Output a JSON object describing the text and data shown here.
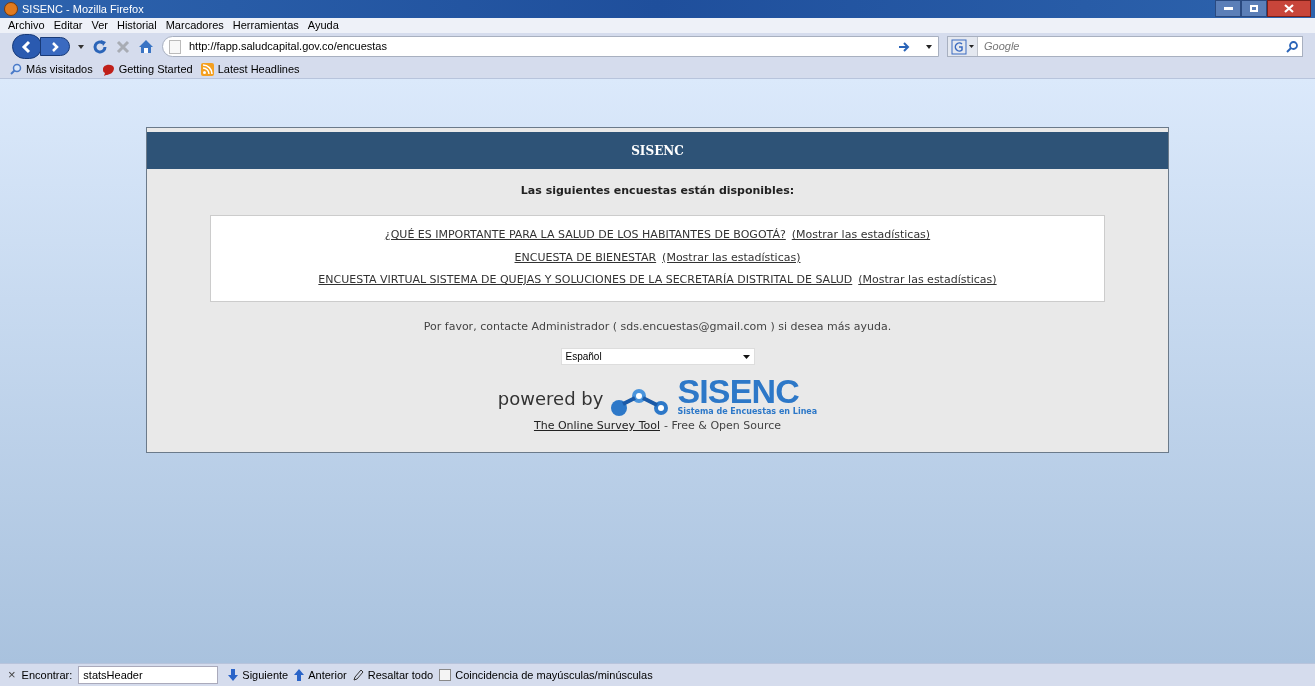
{
  "window": {
    "title": "SISENC - Mozilla Firefox"
  },
  "menu": [
    "Archivo",
    "Editar",
    "Ver",
    "Historial",
    "Marcadores",
    "Herramientas",
    "Ayuda"
  ],
  "address": {
    "value": "http://fapp.saludcapital.gov.co/encuestas"
  },
  "search": {
    "placeholder": "Google"
  },
  "bookmarks": [
    "Más visitados",
    "Getting Started",
    "Latest Headlines"
  ],
  "page": {
    "header": "SISENC",
    "intro": "Las siguientes encuestas están disponibles:",
    "surveys": [
      {
        "title": "¿QUÉ ES IMPORTANTE PARA LA SALUD DE LOS HABITANTES DE BOGOTÁ?",
        "stats": "(Mostrar las estadísticas)"
      },
      {
        "title": "ENCUESTA DE BIENESTAR",
        "stats": "(Mostrar las estadísticas)"
      },
      {
        "title": "ENCUESTA VIRTUAL SISTEMA DE QUEJAS Y SOLUCIONES DE LA SECRETARÍA DISTRITAL DE SALUD",
        "stats": "(Mostrar las estadísticas)"
      }
    ],
    "contact": "Por favor, contacte Administrador ( sds.encuestas@gmail.com ) si desea más ayuda.",
    "language": "Español",
    "powered_by": "powered by",
    "logo_name": "SISENC",
    "logo_tagline": "Sistema de Encuestas en Linea",
    "tool_link": "The Online Survey Tool",
    "tool_note": "- Free & Open Source"
  },
  "find_bar": {
    "close": "×",
    "label": "Encontrar:",
    "value": "statsHeader",
    "next": "Siguiente",
    "previous": "Anterior",
    "highlight": "Resaltar todo",
    "match_case": {
      "label": "Coincidencia de mayúsculas/minúsculas",
      "checked": false
    }
  }
}
